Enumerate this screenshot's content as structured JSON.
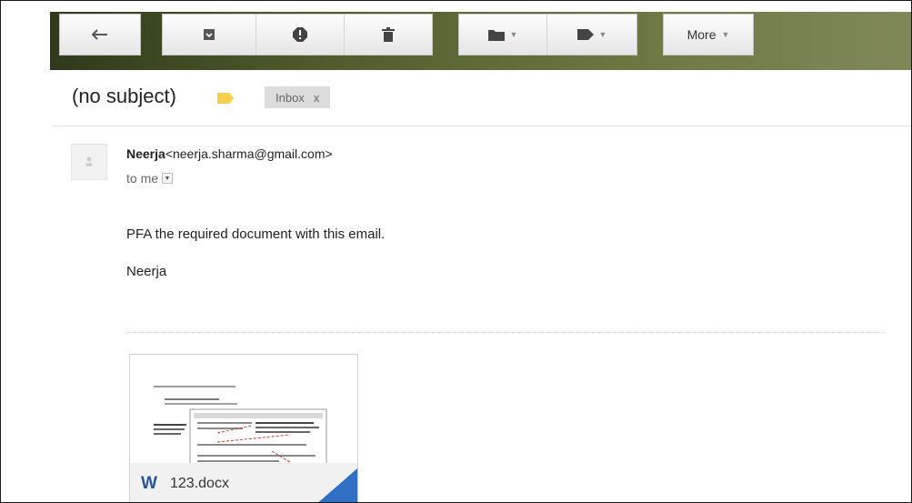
{
  "toolbar": {
    "more_label": "More",
    "icons": [
      "back-arrow-icon",
      "archive-icon",
      "report-spam-icon",
      "delete-icon",
      "move-to-folder-icon",
      "label-icon"
    ]
  },
  "message": {
    "subject": "(no subject)",
    "label_chip": {
      "text": "Inbox",
      "remove": "x"
    },
    "sender_name": "Neerja",
    "sender_email": "<neerja.sharma@gmail.com>",
    "to_label": "to me",
    "body_line1": "PFA the required document with this email.",
    "body_line2": "Neerja"
  },
  "attachment": {
    "icon_letter": "W",
    "filename": "123.docx"
  },
  "colors": {
    "toolbar_bg": "#4e5a2c",
    "label_yellow": "#f6d04a",
    "word_blue": "#2a5699",
    "corner_blue": "#2f6fc4"
  }
}
